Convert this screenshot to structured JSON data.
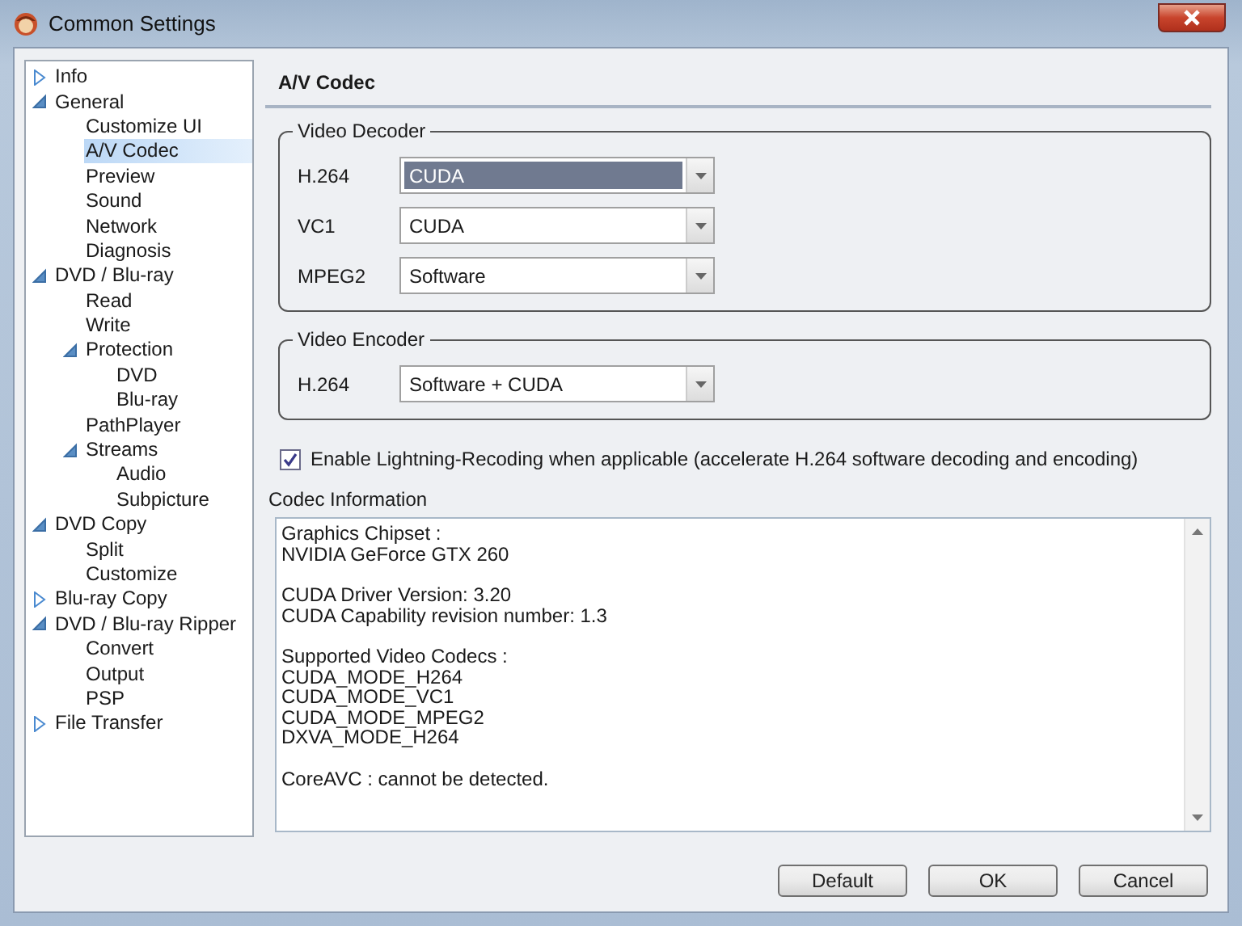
{
  "window": {
    "title": "Common Settings"
  },
  "sidebar": {
    "items": [
      {
        "label": "Info",
        "selected": false,
        "expanded": false
      },
      {
        "label": "General",
        "selected": false,
        "expanded": true,
        "children": [
          {
            "label": "Customize UI",
            "selected": false
          },
          {
            "label": "A/V Codec",
            "selected": true
          },
          {
            "label": "Preview",
            "selected": false
          },
          {
            "label": "Sound",
            "selected": false
          },
          {
            "label": "Network",
            "selected": false
          },
          {
            "label": "Diagnosis",
            "selected": false
          }
        ]
      },
      {
        "label": "DVD / Blu-ray",
        "selected": false,
        "expanded": true,
        "children": [
          {
            "label": "Read",
            "selected": false
          },
          {
            "label": "Write",
            "selected": false
          },
          {
            "label": "Protection",
            "selected": false,
            "expanded": true,
            "children": [
              {
                "label": "DVD",
                "selected": false
              },
              {
                "label": "Blu-ray",
                "selected": false
              }
            ]
          },
          {
            "label": "PathPlayer",
            "selected": false
          },
          {
            "label": "Streams",
            "selected": false,
            "expanded": true,
            "children": [
              {
                "label": "Audio",
                "selected": false
              },
              {
                "label": "Subpicture",
                "selected": false
              }
            ]
          }
        ]
      },
      {
        "label": "DVD Copy",
        "selected": false,
        "expanded": true,
        "children": [
          {
            "label": "Split",
            "selected": false
          },
          {
            "label": "Customize",
            "selected": false
          }
        ]
      },
      {
        "label": "Blu-ray Copy",
        "selected": false,
        "expanded": false
      },
      {
        "label": "DVD / Blu-ray Ripper",
        "selected": false,
        "expanded": true,
        "children": [
          {
            "label": "Convert",
            "selected": false
          },
          {
            "label": "Output",
            "selected": false
          },
          {
            "label": "PSP",
            "selected": false
          }
        ]
      },
      {
        "label": "File Transfer",
        "selected": false,
        "expanded": false
      }
    ]
  },
  "page_title": "A/V Codec",
  "groups": [
    {
      "title": "Video Decoder",
      "rows": [
        {
          "label": "H.264",
          "value": "CUDA",
          "highlighted": true
        },
        {
          "label": "VC1",
          "value": "CUDA",
          "highlighted": false
        },
        {
          "label": "MPEG2",
          "value": "Software",
          "highlighted": false
        }
      ]
    },
    {
      "title": "Video Encoder",
      "rows": [
        {
          "label": "H.264",
          "value": "Software + CUDA",
          "highlighted": false
        }
      ]
    }
  ],
  "checkbox": {
    "label": "Enable Lightning-Recoding when applicable (accelerate H.264 software decoding and encoding)",
    "checked": true
  },
  "codec_info": {
    "label": "Codec Information",
    "paragraphs": [
      [
        "Graphics Chipset :",
        "NVIDIA GeForce GTX 260"
      ],
      [
        "CUDA Driver Version: 3.20",
        "CUDA Capability revision number: 1.3"
      ],
      [
        "Supported Video Codecs :",
        "CUDA_MODE_H264",
        "CUDA_MODE_VC1",
        "CUDA_MODE_MPEG2",
        "DXVA_MODE_H264"
      ],
      [
        "CoreAVC : cannot be detected."
      ]
    ]
  },
  "buttons": [
    "Default",
    "OK",
    "Cancel"
  ]
}
